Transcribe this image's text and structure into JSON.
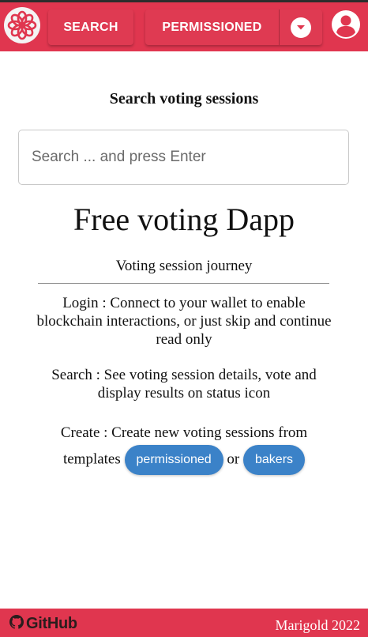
{
  "header": {
    "logo_icon": "marigold-flower-logo-icon",
    "search_label": "SEARCH",
    "permissioned_label": "PERMISSIONED",
    "dropdown_icon": "chevron-down-icon",
    "account_icon": "account-circle-icon",
    "bar_color": "#e0364f"
  },
  "search": {
    "heading": "Search voting sessions",
    "placeholder": "Search ... and press Enter"
  },
  "main": {
    "title": "Free voting Dapp",
    "journey_title": "Voting session journey",
    "login_text": "Login : Connect to your wallet to enable blockchain interactions, or just skip and continue read only",
    "search_text": "Search : See voting session details, vote and display results on status icon",
    "create_text": "Create : Create new voting sessions from templates",
    "or_text": "or",
    "permissioned_pill": "permissioned",
    "bakers_pill": "bakers",
    "pill_color": "#3b82c8"
  },
  "footer": {
    "github_icon": "github-icon",
    "github_label": "GitHub",
    "copyright": "Marigold 2022"
  }
}
